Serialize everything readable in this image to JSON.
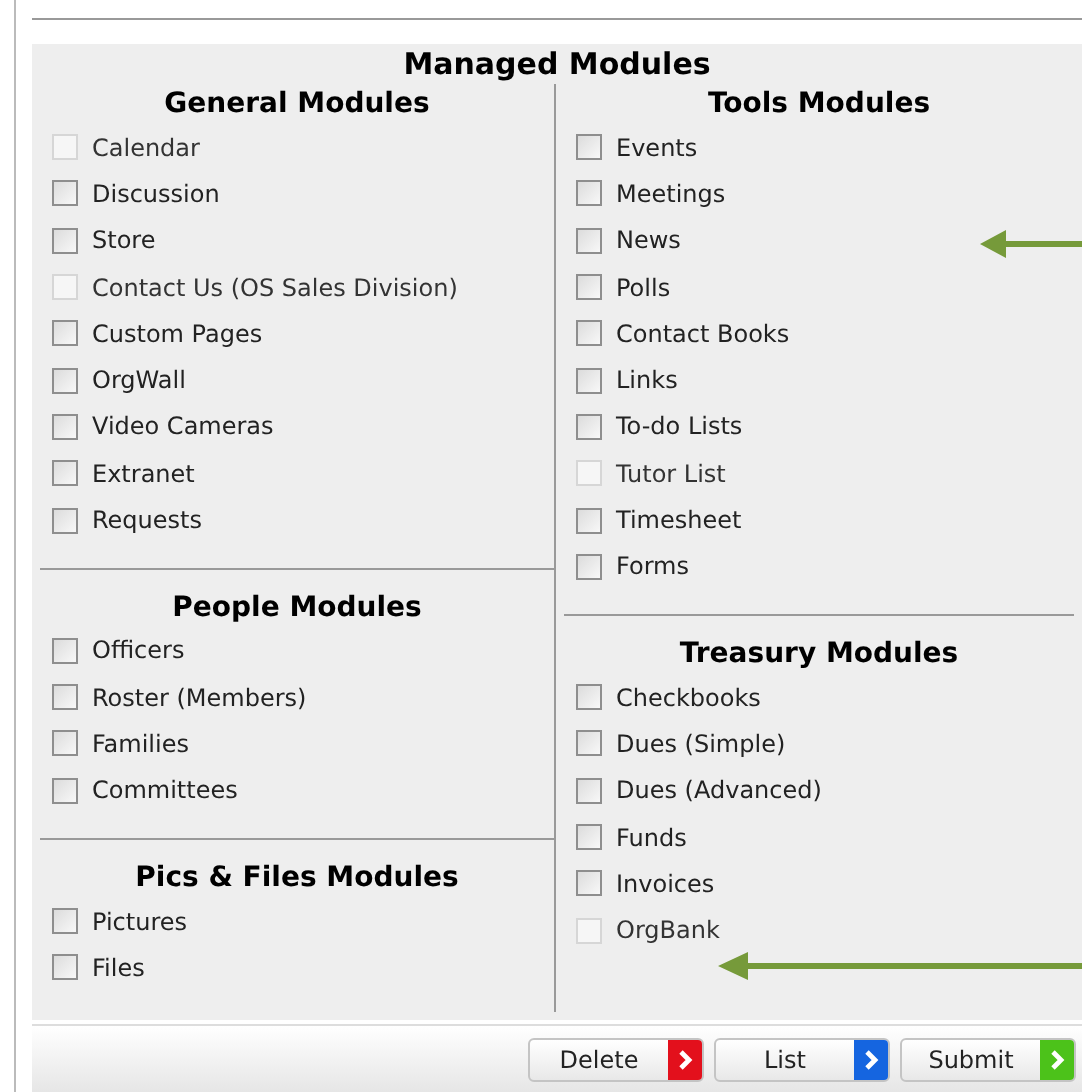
{
  "title": "Managed Modules",
  "columns": [
    [
      {
        "heading": "General Modules",
        "items": [
          {
            "label": "Calendar",
            "checked": false,
            "disabled": true
          },
          {
            "label": "Discussion",
            "checked": false,
            "disabled": false
          },
          {
            "label": "Store",
            "checked": false,
            "disabled": false
          },
          {
            "label": "Contact Us (OS Sales Division)",
            "checked": false,
            "disabled": true
          },
          {
            "label": "Custom Pages",
            "checked": false,
            "disabled": false
          },
          {
            "label": "OrgWall",
            "checked": false,
            "disabled": false
          },
          {
            "label": "Video Cameras",
            "checked": false,
            "disabled": false
          },
          {
            "label": "Extranet",
            "checked": false,
            "disabled": false
          },
          {
            "label": "Requests",
            "checked": false,
            "disabled": false
          }
        ]
      },
      {
        "heading": "People Modules",
        "items": [
          {
            "label": "Officers",
            "checked": false,
            "disabled": false
          },
          {
            "label": "Roster (Members)",
            "checked": false,
            "disabled": false
          },
          {
            "label": "Families",
            "checked": false,
            "disabled": false
          },
          {
            "label": "Committees",
            "checked": false,
            "disabled": false
          }
        ]
      },
      {
        "heading": "Pics & Files Modules",
        "items": [
          {
            "label": "Pictures",
            "checked": false,
            "disabled": false
          },
          {
            "label": "Files",
            "checked": false,
            "disabled": false
          }
        ]
      }
    ],
    [
      {
        "heading": "Tools Modules",
        "items": [
          {
            "label": "Events",
            "checked": false,
            "disabled": false
          },
          {
            "label": "Meetings",
            "checked": false,
            "disabled": false
          },
          {
            "label": "News",
            "checked": false,
            "disabled": false
          },
          {
            "label": "Polls",
            "checked": false,
            "disabled": false
          },
          {
            "label": "Contact Books",
            "checked": false,
            "disabled": false
          },
          {
            "label": "Links",
            "checked": false,
            "disabled": false
          },
          {
            "label": "To-do Lists",
            "checked": false,
            "disabled": false
          },
          {
            "label": "Tutor List",
            "checked": false,
            "disabled": true
          },
          {
            "label": "Timesheet",
            "checked": false,
            "disabled": false
          },
          {
            "label": "Forms",
            "checked": false,
            "disabled": false
          }
        ]
      },
      {
        "heading": "Treasury Modules",
        "items": [
          {
            "label": "Checkbooks",
            "checked": false,
            "disabled": false
          },
          {
            "label": "Dues (Simple)",
            "checked": false,
            "disabled": false
          },
          {
            "label": "Dues (Advanced)",
            "checked": false,
            "disabled": false
          },
          {
            "label": "Funds",
            "checked": false,
            "disabled": false
          },
          {
            "label": "Invoices",
            "checked": false,
            "disabled": false
          },
          {
            "label": "OrgBank",
            "checked": false,
            "disabled": true
          }
        ]
      }
    ]
  ],
  "buttons": [
    {
      "label": "Delete",
      "color": "#e3101c"
    },
    {
      "label": "List",
      "color": "#1565e0"
    },
    {
      "label": "Submit",
      "color": "#4cc21a"
    }
  ]
}
